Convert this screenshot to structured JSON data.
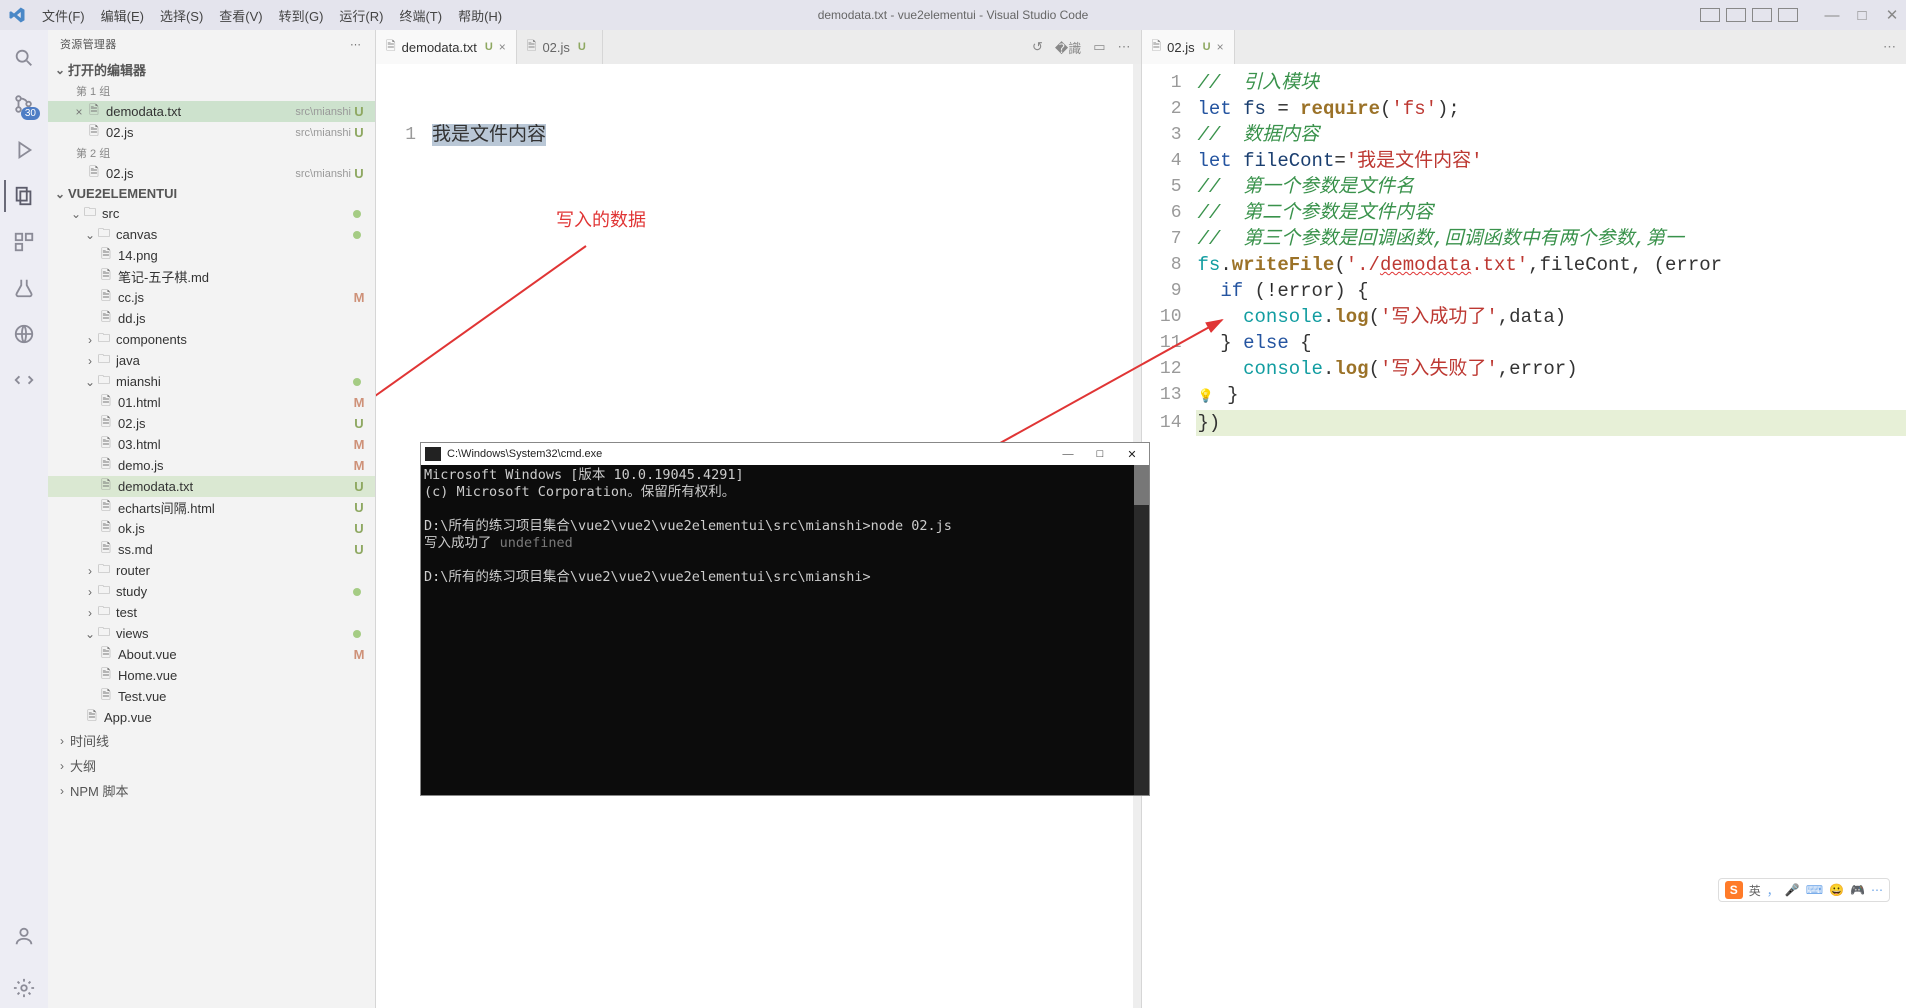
{
  "window_title": "demodata.txt - vue2elementui - Visual Studio Code",
  "menu": [
    "文件(F)",
    "编辑(E)",
    "选择(S)",
    "查看(V)",
    "转到(G)",
    "运行(R)",
    "终端(T)",
    "帮助(H)"
  ],
  "activity": {
    "scm_badge": "30"
  },
  "explorer": {
    "title": "资源管理器",
    "open_editors": "打开的编辑器",
    "group1": "第 1 组",
    "group2": "第 2 组",
    "open": [
      {
        "close": "×",
        "name": "demodata.txt",
        "path": "src\\mianshi",
        "mark": "U",
        "sel": true
      },
      {
        "close": "",
        "name": "02.js",
        "path": "src\\mianshi",
        "mark": "U"
      }
    ],
    "open_g2": [
      {
        "close": "",
        "name": "02.js",
        "path": "src\\mianshi",
        "mark": "U"
      }
    ],
    "project": "VUE2ELEMENTUI",
    "tree": [
      {
        "d": 1,
        "t": "folder",
        "open": true,
        "name": "src",
        "dot": true
      },
      {
        "d": 2,
        "t": "folder",
        "open": true,
        "name": "canvas",
        "dot": true
      },
      {
        "d": 3,
        "t": "file",
        "name": "14.png"
      },
      {
        "d": 3,
        "t": "file",
        "name": "笔记-五子棋.md"
      },
      {
        "d": 3,
        "t": "file",
        "name": "cc.js",
        "mark": "M"
      },
      {
        "d": 3,
        "t": "file",
        "name": "dd.js"
      },
      {
        "d": 2,
        "t": "folder",
        "open": false,
        "name": "components"
      },
      {
        "d": 2,
        "t": "folder",
        "open": false,
        "name": "java"
      },
      {
        "d": 2,
        "t": "folder",
        "open": true,
        "name": "mianshi",
        "dot": true
      },
      {
        "d": 3,
        "t": "file",
        "name": "01.html",
        "mark": "M"
      },
      {
        "d": 3,
        "t": "file",
        "name": "02.js",
        "mark": "U"
      },
      {
        "d": 3,
        "t": "file",
        "name": "03.html",
        "mark": "M"
      },
      {
        "d": 3,
        "t": "file",
        "name": "demo.js",
        "mark": "M"
      },
      {
        "d": 3,
        "t": "file",
        "name": "demodata.txt",
        "mark": "U",
        "sel": true
      },
      {
        "d": 3,
        "t": "file",
        "name": "echarts间隔.html",
        "mark": "U"
      },
      {
        "d": 3,
        "t": "file",
        "name": "ok.js",
        "mark": "U"
      },
      {
        "d": 3,
        "t": "file",
        "name": "ss.md",
        "mark": "U"
      },
      {
        "d": 2,
        "t": "folder",
        "open": false,
        "name": "router"
      },
      {
        "d": 2,
        "t": "folder",
        "open": false,
        "name": "study",
        "dot": true
      },
      {
        "d": 2,
        "t": "folder",
        "open": false,
        "name": "test"
      },
      {
        "d": 2,
        "t": "folder",
        "open": true,
        "name": "views",
        "dot": true
      },
      {
        "d": 3,
        "t": "file",
        "name": "About.vue",
        "mark": "M"
      },
      {
        "d": 3,
        "t": "file",
        "name": "Home.vue"
      },
      {
        "d": 3,
        "t": "file",
        "name": "Test.vue"
      },
      {
        "d": 2,
        "t": "file",
        "name": "App.vue"
      }
    ],
    "footer": [
      "时间线",
      "大纲",
      "NPM 脚本"
    ]
  },
  "editor_left": {
    "tabs": [
      {
        "name": "demodata.txt",
        "status": "U",
        "active": true,
        "close": "×"
      },
      {
        "name": "02.js",
        "status": "U",
        "active": false,
        "close": ""
      }
    ],
    "line_no": "1",
    "content": "我是文件内容",
    "annotation": "写入的数据"
  },
  "editor_right": {
    "tabs": [
      {
        "name": "02.js",
        "status": "U",
        "active": true,
        "close": "×"
      }
    ],
    "lines": [
      {
        "n": 1,
        "html": "<span class='c-cmt'>//  引入模块</span>"
      },
      {
        "n": 2,
        "html": "<span class='c-kw'>let</span> <span class='c-id'>fs</span> <span class='c-op'>=</span> <span class='c-fn'>require</span>(<span class='c-str'>'fs'</span>);"
      },
      {
        "n": 3,
        "html": "<span class='c-cmt'>//  数据内容</span>"
      },
      {
        "n": 4,
        "html": "<span class='c-kw'>let</span> <span class='c-id'>fileCont</span><span class='c-op'>=</span><span class='c-str'>'我是文件内容'</span>"
      },
      {
        "n": 5,
        "html": "<span class='c-cmt'>//  第一个参数是文件名</span>"
      },
      {
        "n": 6,
        "html": "<span class='c-cmt'>//  第二个参数是文件内容</span>"
      },
      {
        "n": 7,
        "html": "<span class='c-cmt'>//  第三个参数是回调函数,回调函数中有两个参数,第一</span>"
      },
      {
        "n": 8,
        "html": "<span class='c-cy'>fs</span>.<span class='c-fn'>writeFile</span>(<span class='c-str'>'./<span class='underline-wavy'>demodata</span>.txt'</span>,fileCont, (error"
      },
      {
        "n": 9,
        "html": "  <span class='c-kw'>if</span> (<span class='c-op'>!</span>error) {"
      },
      {
        "n": 10,
        "html": "    <span class='c-cy'>console</span>.<span class='c-fn'>log</span>(<span class='c-str'>'写入成功了'</span>,data)"
      },
      {
        "n": 11,
        "html": "  } <span class='c-kw'>else</span> {"
      },
      {
        "n": 12,
        "html": "    <span class='c-cy'>console</span>.<span class='c-fn'>log</span>(<span class='c-str'>'写入失败了'</span>,error)"
      },
      {
        "n": 13,
        "html": "<span class='bulb'>💡</span> }"
      },
      {
        "n": 14,
        "html": "})",
        "hl": true
      }
    ]
  },
  "cmd": {
    "title": "C:\\Windows\\System32\\cmd.exe",
    "lines": [
      "Microsoft Windows [版本 10.0.19045.4291]",
      "(c) Microsoft Corporation。保留所有权利。",
      "",
      "D:\\所有的练习项目集合\\vue2\\vue2\\vue2elementui\\src\\mianshi>node 02.js",
      {
        "ok": "写入成功了 ",
        "und": "undefined"
      },
      "",
      "D:\\所有的练习项目集合\\vue2\\vue2\\vue2elementui\\src\\mianshi>"
    ],
    "winbtn": [
      "—",
      "□",
      "✕"
    ]
  },
  "ime": {
    "lang": "英",
    "items": [
      "，",
      "🎤",
      "⌨",
      "😀",
      "🎮",
      "⋯"
    ]
  }
}
